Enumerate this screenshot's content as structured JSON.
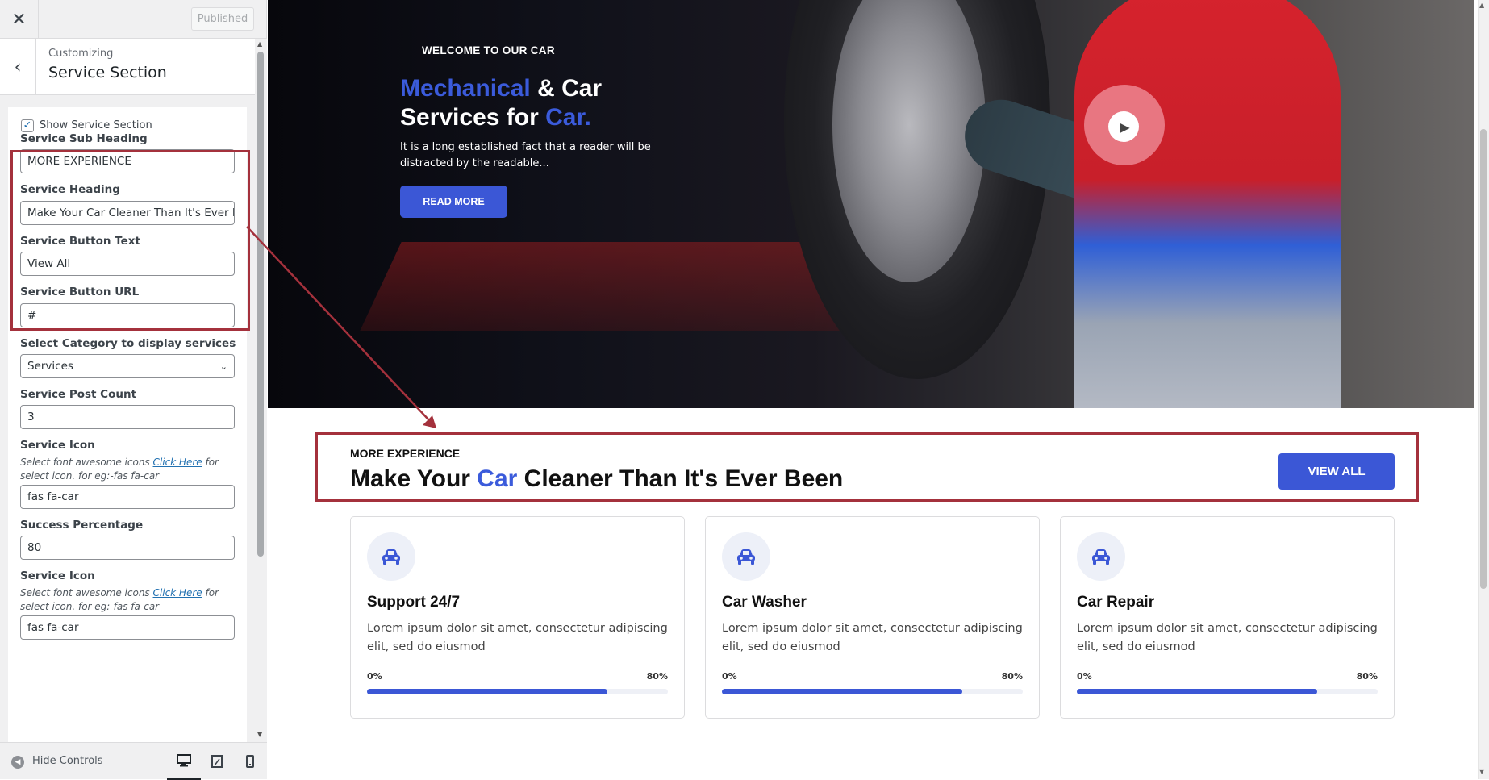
{
  "header": {
    "close_icon": "close-icon",
    "published_label": "Published"
  },
  "section_header": {
    "back_icon": "chevron-left-icon",
    "customizing_label": "Customizing",
    "title": "Service Section"
  },
  "controls": {
    "show_section_label": "Show Service Section",
    "show_section_checked": true,
    "sub_heading": {
      "label": "Service Sub Heading",
      "value": "MORE EXPERIENCE"
    },
    "heading": {
      "label": "Service Heading",
      "value": "Make Your Car Cleaner Than It's Ever Been"
    },
    "button_text": {
      "label": "Service Button Text",
      "value": "View All"
    },
    "button_url": {
      "label": "Service Button URL",
      "value": "#"
    },
    "category": {
      "label": "Select Category to display services",
      "value": "Services"
    },
    "post_count": {
      "label": "Service Post Count",
      "value": "3"
    },
    "icon1": {
      "label": "Service Icon",
      "desc_before": "Select font awesome icons ",
      "desc_link": "Click Here",
      "desc_after": " for select icon. for eg:-fas fa-car",
      "value": "fas fa-car"
    },
    "success_percentage": {
      "label": "Success Percentage",
      "value": "80"
    },
    "icon2": {
      "label": "Service Icon",
      "desc_before": "Select font awesome icons ",
      "desc_link": "Click Here",
      "desc_after": " for select icon. for eg:-fas fa-car",
      "value": "fas fa-car"
    }
  },
  "footer": {
    "hide_controls_label": "Hide Controls",
    "devices": [
      "desktop-icon",
      "tablet-icon",
      "mobile-icon"
    ]
  },
  "hero": {
    "kicker": "WELCOME TO OUR CAR",
    "title_accent1": "Mechanical",
    "title_mid": " & Car Services for ",
    "title_accent2": "Car.",
    "description": "It is a long established fact that a reader will be distracted by the readable...",
    "button_label": "READ MORE",
    "play_icon": "play-icon"
  },
  "service_section": {
    "sub_heading": "MORE EXPERIENCE",
    "heading_before": "Make Your ",
    "heading_accent": "Car",
    "heading_after": " Cleaner Than It's Ever Been",
    "button_label": "VIEW ALL",
    "cards": [
      {
        "icon": "car-icon",
        "title": "Support 24/7",
        "description": "Lorem ipsum dolor sit amet, consectetur adipiscing elit, sed do eiusmod",
        "bar_min": "0%",
        "bar_max": "80%",
        "progress": 0.8
      },
      {
        "icon": "car-icon",
        "title": "Car Washer",
        "description": "Lorem ipsum dolor sit amet, consectetur adipiscing elit, sed do eiusmod",
        "bar_min": "0%",
        "bar_max": "80%",
        "progress": 0.8
      },
      {
        "icon": "car-icon",
        "title": "Car Repair",
        "description": "Lorem ipsum dolor sit amet, consectetur adipiscing elit, sed do eiusmod",
        "bar_min": "0%",
        "bar_max": "80%",
        "progress": 0.8
      }
    ]
  },
  "colors": {
    "accent": "#3b57d6",
    "annotation": "#a4313c"
  }
}
